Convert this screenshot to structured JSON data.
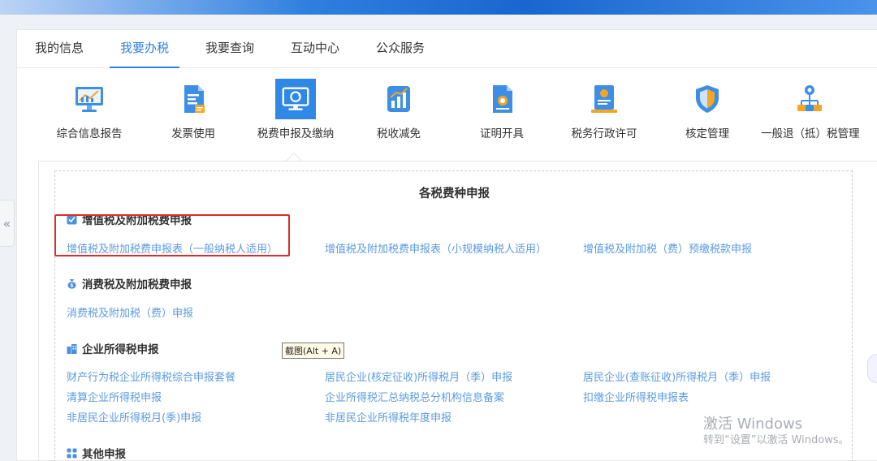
{
  "tabs": [
    {
      "label": "我的信息"
    },
    {
      "label": "我要办税"
    },
    {
      "label": "我要查询"
    },
    {
      "label": "互动中心"
    },
    {
      "label": "公众服务"
    }
  ],
  "categories": [
    {
      "label": "综合信息报告",
      "icon": "monitor-chart-icon"
    },
    {
      "label": "发票使用",
      "icon": "invoice-doc-icon"
    },
    {
      "label": "税费申报及缴纳",
      "icon": "monitor-refresh-icon"
    },
    {
      "label": "税收减免",
      "icon": "bar-chart-icon"
    },
    {
      "label": "证明开具",
      "icon": "certificate-doc-icon"
    },
    {
      "label": "税务行政许可",
      "icon": "award-doc-icon"
    },
    {
      "label": "核定管理",
      "icon": "shield-icon"
    },
    {
      "label": "一般退（抵）税管理",
      "icon": "network-person-icon"
    }
  ],
  "section_title": "各税费种申报",
  "groups": [
    {
      "title": "增值税及附加税费申报",
      "links": [
        "增值税及附加税费申报表（一般纳税人适用）",
        "增值税及附加税费申报表（小规模纳税人适用）",
        "增值税及附加税（费）预缴税款申报"
      ]
    },
    {
      "title": "消费税及附加税费申报",
      "links": [
        "消费税及附加税（费）申报"
      ]
    },
    {
      "title": "企业所得税申报",
      "links": [
        "财产行为税企业所得税综合申报套餐",
        "居民企业(核定征收)所得税月（季）申报",
        "居民企业(查账征收)所得税月（季）申报",
        "清算企业所得税申报",
        "企业所得税汇总纳税总分机构信息备案",
        "扣缴企业所得税申报表",
        "非居民企业所得税月(季)申报",
        "非居民企业所得税年度申报"
      ]
    },
    {
      "title": "其他申报",
      "links": []
    }
  ],
  "tooltip": "截图(Alt + A)",
  "watermark": {
    "line1": "激活 Windows",
    "line2": "转到“设置”以激活 Windows。"
  },
  "collapse_glyph": "«",
  "colors": {
    "accent": "#2f7fe0",
    "link": "#5b9be0",
    "highlight": "#e02b2b"
  }
}
